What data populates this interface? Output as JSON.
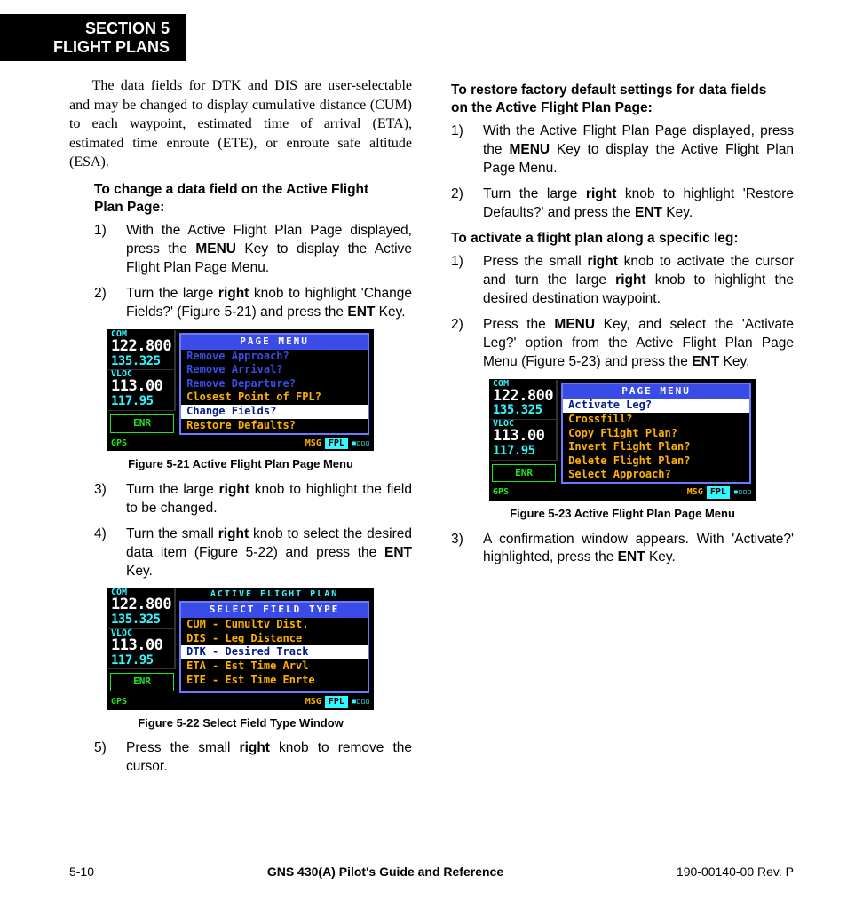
{
  "header": {
    "line1": "SECTION 5",
    "line2": "FLIGHT PLANS"
  },
  "intro": "The data fields for DTK and DIS are user-selectable and may be changed to display cumulative distance (CUM) to each waypoint, estimated time of arrival (ETA), estimated time enroute (ETE), or enroute safe altitude (ESA).",
  "procA": {
    "heading": "To change a data field on the Active Flight Plan Page:",
    "steps": [
      {
        "n": "1)",
        "pre": "With the Active Flight Plan Page displayed, press the ",
        "b1": "MENU",
        "post": " Key to display the Active Flight Plan Page Menu."
      },
      {
        "n": "2)",
        "pre": "Turn the large ",
        "b1": "right",
        "mid": " knob to highlight 'Change Fields?' (Figure 5-21) and press the ",
        "b2": "ENT",
        "post": " Key."
      },
      {
        "n": "3)",
        "pre": "Turn the large ",
        "b1": "right",
        "post": " knob to highlight the field to be changed."
      },
      {
        "n": "4)",
        "pre": "Turn the small ",
        "b1": "right",
        "mid": " knob to select the desired data item (Figure 5-22) and press the ",
        "b2": "ENT",
        "post": " Key."
      },
      {
        "n": "5)",
        "pre": "Press the small ",
        "b1": "right",
        "post": " knob to remove the cursor."
      }
    ]
  },
  "procB": {
    "heading": "To restore factory default settings for data fields on the Active Flight Plan Page:",
    "steps": [
      {
        "n": "1)",
        "pre": "With the Active Flight Plan Page displayed, press the ",
        "b1": "MENU",
        "post": " Key to display the Active Flight Plan Page Menu."
      },
      {
        "n": "2)",
        "pre": "Turn the large ",
        "b1": "right",
        "mid": " knob to highlight 'Restore Defaults?' and press the ",
        "b2": "ENT",
        "post": " Key."
      }
    ]
  },
  "procC": {
    "heading": "To activate a flight plan along a specific leg:",
    "steps": [
      {
        "n": "1)",
        "pre": "Press the small ",
        "b1": "right",
        "mid": " knob to activate the cursor and turn the large ",
        "b2": "right",
        "post": " knob to highlight the desired destination waypoint."
      },
      {
        "n": "2)",
        "pre": "Press the ",
        "b1": "MENU",
        "mid": " Key, and select the 'Activate Leg?' option from the Active Flight Plan Page Menu (Figure 5-23) and press the ",
        "b2": "ENT",
        "post": " Key."
      },
      {
        "n": "3)",
        "pre": "A confirmation window appears. With 'Activate?' highlighted, press the ",
        "b1": "ENT",
        "post": " Key."
      }
    ]
  },
  "freqs": {
    "com_label": "COM",
    "com_active": "122.800",
    "com_standby": "135.325",
    "vloc_label": "VLOC",
    "vloc_active": "113.00",
    "vloc_standby": "117.95",
    "enr": "ENR",
    "gps": "GPS",
    "msg": "MSG",
    "fpl": "FPL"
  },
  "fig21": {
    "caption": "Figure 5-21  Active Flight Plan Page Menu",
    "screen_title": "",
    "menu_title": "PAGE MENU",
    "items": [
      {
        "t": "Remove Approach?",
        "cls": ""
      },
      {
        "t": "Remove Arrival?",
        "cls": ""
      },
      {
        "t": "Remove Departure?",
        "cls": ""
      },
      {
        "t": "Closest Point of FPL?",
        "cls": "enabled"
      },
      {
        "t": "Change Fields?",
        "cls": "selected"
      },
      {
        "t": "Restore Defaults?",
        "cls": "enabled"
      }
    ]
  },
  "fig22": {
    "caption": "Figure 5-22  Select Field Type Window",
    "screen_title": "ACTIVE FLIGHT PLAN",
    "menu_title": "SELECT FIELD TYPE",
    "items": [
      {
        "t": "CUM  - Cumultv Dist.",
        "cls": "enabled"
      },
      {
        "t": "DIS  - Leg Distance",
        "cls": "enabled"
      },
      {
        "t": "DTK  - Desired Track",
        "cls": "selected"
      },
      {
        "t": "ETA  - Est Time Arvl",
        "cls": "enabled"
      },
      {
        "t": "ETE  - Est Time Enrte",
        "cls": "enabled"
      }
    ]
  },
  "fig23": {
    "caption": "Figure 5-23  Active Flight Plan Page Menu",
    "screen_title": "",
    "menu_title": "PAGE MENU",
    "items": [
      {
        "t": "Activate Leg?",
        "cls": "selected"
      },
      {
        "t": "Crossfill?",
        "cls": "enabled"
      },
      {
        "t": "Copy Flight Plan?",
        "cls": "enabled"
      },
      {
        "t": "Invert Flight Plan?",
        "cls": "enabled"
      },
      {
        "t": "Delete Flight Plan?",
        "cls": "enabled"
      },
      {
        "t": "Select Approach?",
        "cls": "enabled"
      }
    ]
  },
  "footer": {
    "left": "5-10",
    "center": "GNS 430(A) Pilot's Guide and Reference",
    "right": "190-00140-00  Rev. P"
  }
}
